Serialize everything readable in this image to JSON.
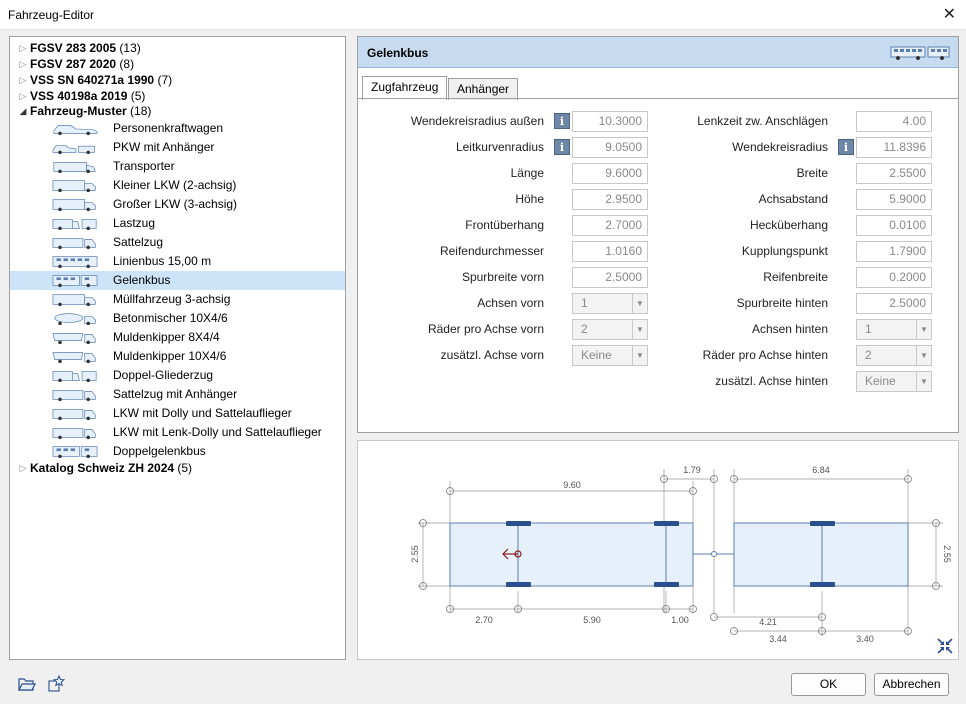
{
  "window": {
    "title": "Fahrzeug-Editor"
  },
  "tree": {
    "top_nodes": [
      {
        "label": "FGSV 283 2005",
        "count": "(13)"
      },
      {
        "label": "FGSV 287 2020",
        "count": "(8)"
      },
      {
        "label": "VSS SN 640271a 1990",
        "count": "(7)"
      },
      {
        "label": "VSS 40198a 2019",
        "count": "(5)"
      }
    ],
    "expanded_node": {
      "label": "Fahrzeug-Muster",
      "count": "(18)"
    },
    "children": [
      "Personenkraftwagen",
      "PKW mit Anhänger",
      "Transporter",
      "Kleiner LKW (2-achsig)",
      "Großer LKW (3-achsig)",
      "Lastzug",
      "Sattelzug",
      "Linienbus 15,00 m",
      "Gelenkbus",
      "Müllfahrzeug 3-achsig",
      "Betonmischer 10X4/6",
      "Muldenkipper 8X4/4",
      "Muldenkipper 10X4/6",
      "Doppel-Gliederzug",
      "Sattelzug  mit Anhänger",
      "LKW mit Dolly und Sattelauflieger",
      "LKW mit Lenk-Dolly und Sattelauflieger",
      "Doppelgelenkbus"
    ],
    "selected_index": 8,
    "last_node": {
      "label": "Katalog Schweiz ZH 2024",
      "count": "(5)"
    }
  },
  "panel": {
    "title": "Gelenkbus",
    "tabs": [
      "Zugfahrzeug",
      "Anhänger"
    ],
    "active_tab": 0,
    "left_fields": [
      {
        "label": "Wendekreisradius außen",
        "value": "10.3000",
        "info": true,
        "type": "input"
      },
      {
        "label": "Leitkurvenradius",
        "value": "9.0500",
        "info": true,
        "type": "input"
      },
      {
        "label": "Länge",
        "value": "9.6000",
        "type": "input"
      },
      {
        "label": "Höhe",
        "value": "2.9500",
        "type": "input"
      },
      {
        "label": "Frontüberhang",
        "value": "2.7000",
        "type": "input"
      },
      {
        "label": "Reifendurchmesser",
        "value": "1.0160",
        "type": "input"
      },
      {
        "label": "Spurbreite vorn",
        "value": "2.5000",
        "type": "input"
      },
      {
        "label": "Achsen vorn",
        "value": "1",
        "type": "select"
      },
      {
        "label": "Räder pro Achse vorn",
        "value": "2",
        "type": "select"
      },
      {
        "label": "zusätzl. Achse vorn",
        "value": "Keine",
        "type": "select"
      }
    ],
    "right_fields": [
      {
        "label": "Lenkzeit zw. Anschlägen",
        "value": "4.00",
        "type": "input"
      },
      {
        "label": "Wendekreisradius",
        "value": "11.8396",
        "info": true,
        "type": "input"
      },
      {
        "label": "Breite",
        "value": "2.5500",
        "type": "input"
      },
      {
        "label": "Achsabstand",
        "value": "5.9000",
        "type": "input"
      },
      {
        "label": "Hecküberhang",
        "value": "0.0100",
        "type": "input"
      },
      {
        "label": "Kupplungspunkt",
        "value": "1.7900",
        "type": "input"
      },
      {
        "label": "Reifenbreite",
        "value": "0.2000",
        "type": "input"
      },
      {
        "label": "Spurbreite hinten",
        "value": "2.5000",
        "type": "input"
      },
      {
        "label": "Achsen hinten",
        "value": "1",
        "type": "select"
      },
      {
        "label": "Räder pro Achse hinten",
        "value": "2",
        "type": "select"
      },
      {
        "label": "zusätzl. Achse hinten",
        "value": "Keine",
        "type": "select"
      }
    ]
  },
  "diagram": {
    "dims": {
      "top_length": "9.60",
      "top_coupling": "1.79",
      "top_trailer": "6.84",
      "left_width": "2.55",
      "right_width": "2.55",
      "bottom_front": "2.70",
      "bottom_wheelbase": "5.90",
      "bottom_rear": "1.00",
      "bottom_trailer_a": "4.21",
      "bottom_trailer_b": "3.44",
      "bottom_trailer_c": "3.40"
    }
  },
  "buttons": {
    "ok": "OK",
    "cancel": "Abbrechen"
  },
  "colors": {
    "header_bg": "#c7dbf0",
    "selection": "#cce4f7",
    "vehicle_fill": "#e6f0fb",
    "axle": "#2b4f8c"
  }
}
